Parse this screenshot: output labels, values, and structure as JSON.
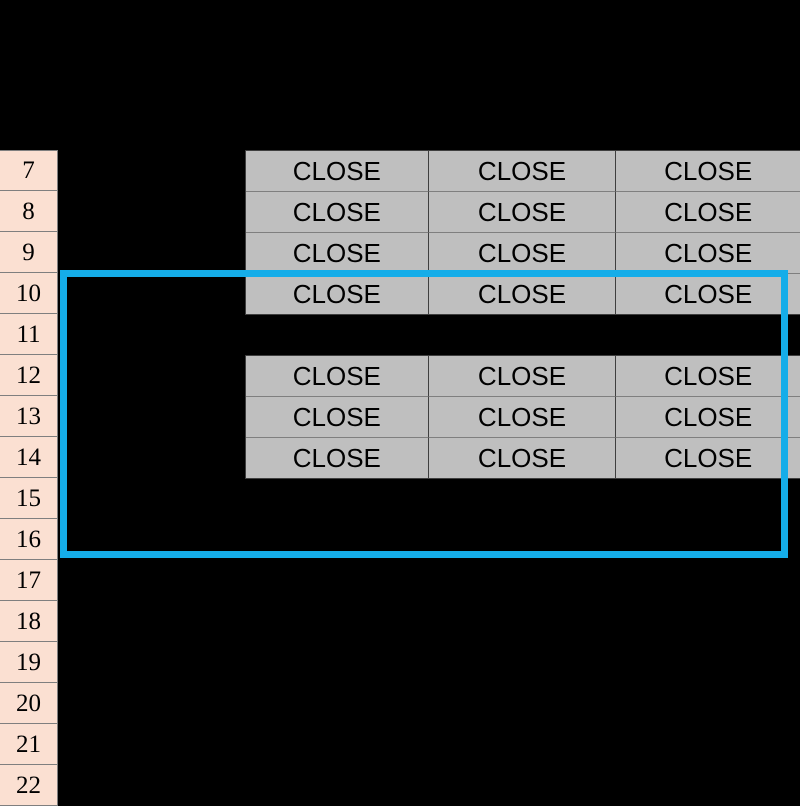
{
  "spreadsheet": {
    "row_headers": [
      "7",
      "8",
      "9",
      "10",
      "11",
      "12",
      "13",
      "14",
      "15",
      "16",
      "17",
      "18",
      "19",
      "20",
      "21",
      "22"
    ],
    "colors": {
      "row_header_fill": "#FBE0D2",
      "cell_fill": "#BFBFBF",
      "canvas": "#000000",
      "selection_border": "#15ADE9",
      "grid_line": "#7F7F7F",
      "text": "#000000"
    },
    "blocks": [
      {
        "name": "upper-block",
        "start_row": "7",
        "rows": [
          {
            "row": "7",
            "cells": [
              "CLOSE",
              "CLOSE",
              "CLOSE"
            ]
          },
          {
            "row": "8",
            "cells": [
              "CLOSE",
              "CLOSE",
              "CLOSE"
            ]
          },
          {
            "row": "9",
            "cells": [
              "CLOSE",
              "CLOSE",
              "CLOSE"
            ]
          },
          {
            "row": "10",
            "cells": [
              "CLOSE",
              "CLOSE",
              "CLOSE"
            ]
          }
        ]
      },
      {
        "name": "lower-block",
        "start_row": "12",
        "rows": [
          {
            "row": "12",
            "cells": [
              "CLOSE",
              "CLOSE",
              "CLOSE"
            ]
          },
          {
            "row": "13",
            "cells": [
              "CLOSE",
              "CLOSE",
              "CLOSE"
            ]
          },
          {
            "row": "14",
            "cells": [
              "CLOSE",
              "CLOSE",
              "CLOSE"
            ]
          }
        ]
      }
    ],
    "selection": {
      "label": "selection-rectangle",
      "top_row": "10",
      "bottom_row": "16"
    }
  }
}
